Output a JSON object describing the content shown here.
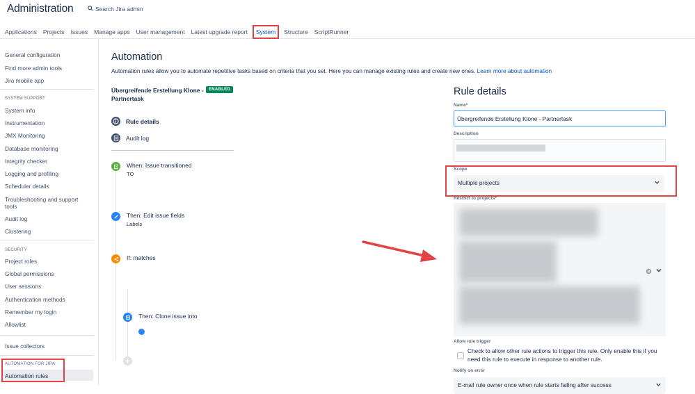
{
  "header": {
    "title": "Administration",
    "search_placeholder": "Search Jira admin"
  },
  "nav": {
    "tabs": [
      "Applications",
      "Projects",
      "Issues",
      "Manage apps",
      "User management",
      "Latest upgrade report",
      "System",
      "Structure",
      "ScriptRunner"
    ],
    "active": "System"
  },
  "sidebar": {
    "top_items": [
      "General configuration",
      "Find more admin tools",
      "Jira mobile app"
    ],
    "system_support_heading": "SYSTEM SUPPORT",
    "system_support_items": [
      "System info",
      "Instrumentation",
      "JMX Monitoring",
      "Database monitoring",
      "Integrity checker",
      "Logging and profiling",
      "Scheduler details",
      "Troubleshooting and support tools",
      "Audit log",
      "Clustering"
    ],
    "security_heading": "SECURITY",
    "security_items": [
      "Project roles",
      "Global permissions",
      "User sessions",
      "Authentication methods",
      "Remember my login",
      "Allowlist"
    ],
    "issue_collectors": "Issue collectors",
    "automation_heading": "AUTOMATION FOR JIRA",
    "automation_rules": "Automation rules"
  },
  "main": {
    "title": "Automation",
    "description": "Automation rules allow you to automate repetitive tasks based on criteria that you set. Here you can manage existing rules and create new ones.",
    "learn_more": "Learn more about automation",
    "rule_name": "Übergreifende Erstellung Klone - Partnertask",
    "status_badge": "ENABLED",
    "menu": {
      "rule_details": "Rule details",
      "audit_log": "Audit log"
    },
    "steps": [
      {
        "title": "When: Issue transitioned",
        "sub": "TO"
      },
      {
        "title": "Then: Edit issue fields",
        "sub": "Labels"
      },
      {
        "title": "If: matches",
        "sub": ""
      },
      {
        "title": "Then: Clone issue into",
        "sub": ""
      }
    ]
  },
  "panel": {
    "title": "Rule details",
    "name_label": "Name",
    "name_value": "Übergreifende Erstellung Klone - Partnertask",
    "description_label": "Description",
    "scope_label": "Scope",
    "scope_value": "Multiple projects",
    "restrict_label": "Restrict to projects",
    "allow_trigger_label": "Allow rule trigger",
    "allow_trigger_text": "Check to allow other rule actions to trigger this rule. Only enable this if you need this rule to execute in response to another rule.",
    "notify_label": "Notify on error",
    "notify_value": "E-mail rule owner once when rule starts failing after success"
  },
  "colors": {
    "accent": "#0052cc",
    "highlight": "#e04444",
    "enabled": "#00875a"
  }
}
